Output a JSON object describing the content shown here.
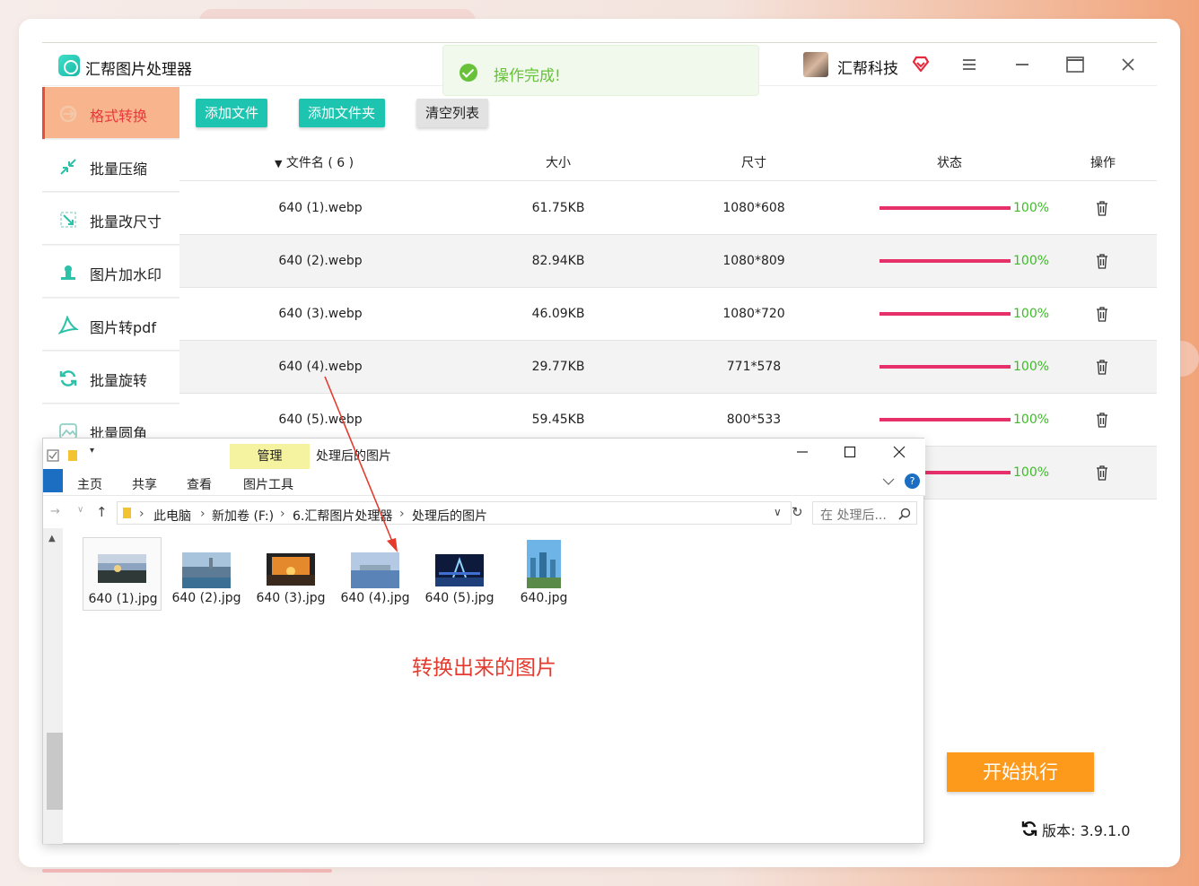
{
  "app": {
    "title": "汇帮图片处理器",
    "user": "汇帮科技",
    "toast": "操作完成!"
  },
  "sidebar": {
    "items": [
      {
        "label": "格式转换",
        "icon": "format-convert-icon"
      },
      {
        "label": "批量压缩",
        "icon": "compress-icon"
      },
      {
        "label": "批量改尺寸",
        "icon": "resize-icon"
      },
      {
        "label": "图片加水印",
        "icon": "watermark-icon"
      },
      {
        "label": "图片转pdf",
        "icon": "pdf-icon"
      },
      {
        "label": "批量旋转",
        "icon": "rotate-icon"
      },
      {
        "label": "批量圆角",
        "icon": "round-corner-icon"
      }
    ]
  },
  "toolbar": {
    "add_file": "添加文件",
    "add_folder": "添加文件夹",
    "clear_list": "清空列表"
  },
  "table": {
    "headers": {
      "name": "文件名 ( 6 )",
      "size": "大小",
      "dimension": "尺寸",
      "status": "状态",
      "action": "操作"
    },
    "rows": [
      {
        "name": "640 (1).webp",
        "size": "61.75KB",
        "dimension": "1080*608",
        "progress": "100%"
      },
      {
        "name": "640 (2).webp",
        "size": "82.94KB",
        "dimension": "1080*809",
        "progress": "100%"
      },
      {
        "name": "640 (3).webp",
        "size": "46.09KB",
        "dimension": "1080*720",
        "progress": "100%"
      },
      {
        "name": "640 (4).webp",
        "size": "29.77KB",
        "dimension": "771*578",
        "progress": "100%"
      },
      {
        "name": "640 (5).webp",
        "size": "59.45KB",
        "dimension": "800*533",
        "progress": "100%"
      },
      {
        "name": "",
        "size": "",
        "dimension": "",
        "progress": "100%"
      }
    ]
  },
  "start_button": "开始执行",
  "version": "版本:  3.9.1.0",
  "explorer": {
    "manage_tab": "管理",
    "title": "处理后的图片",
    "tabs": [
      "主页",
      "共享",
      "查看",
      "图片工具"
    ],
    "breadcrumbs": [
      "此电脑",
      "新加卷 (F:)",
      "6.汇帮图片处理器",
      "处理后的图片"
    ],
    "search_placeholder": "在 处理后...",
    "files": [
      "640 (1).jpg",
      "640 (2).jpg",
      "640 (3).jpg",
      "640 (4).jpg",
      "640 (5).jpg",
      "640.jpg"
    ],
    "note": "转换出来的图片"
  },
  "colors": {
    "accent": "#1dc5b0",
    "active_bg": "#f8b58d",
    "progress": "#e5306a",
    "success": "#67c23a",
    "start": "#fd9a1c",
    "note": "#e53b2e"
  }
}
